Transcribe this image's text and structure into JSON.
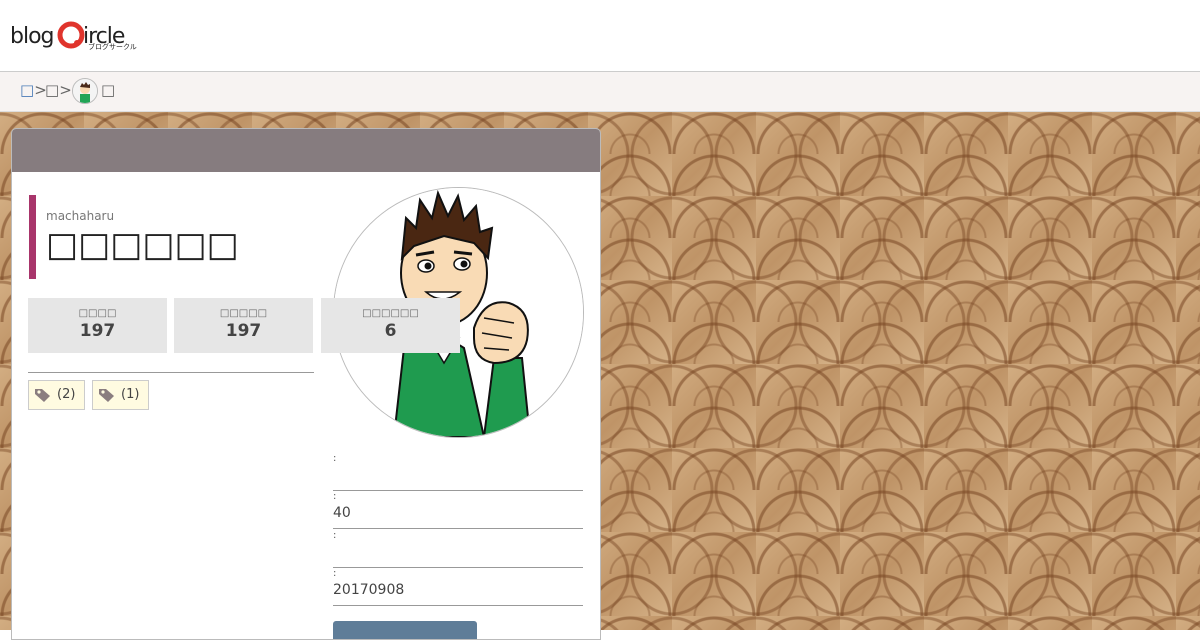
{
  "header": {
    "logo_text": "blogcircle",
    "logo_sub": "ブログサークル"
  },
  "breadcrumb": {
    "items": [
      "□",
      "□",
      "□"
    ],
    "separator": ">"
  },
  "profile": {
    "user_id": "machaharu",
    "display_name": "□□□□□□",
    "stats": [
      {
        "label": "□□□□",
        "value": "197"
      },
      {
        "label": "□□□□□",
        "value": "197"
      },
      {
        "label": "□□□□□□",
        "value": "6"
      }
    ],
    "tags": [
      {
        "count": "(2)"
      },
      {
        "count": "(1)"
      }
    ],
    "fields": [
      {
        "colon": ":",
        "value": ""
      },
      {
        "colon": ":",
        "value": "40"
      },
      {
        "colon": ":",
        "value": ""
      },
      {
        "colon": ":",
        "value": "20170908"
      }
    ]
  },
  "colors": {
    "card_header": "#867c7f",
    "name_accent": "#a8356b",
    "button": "#5f7d98",
    "logo_accent": "#e0342c"
  }
}
